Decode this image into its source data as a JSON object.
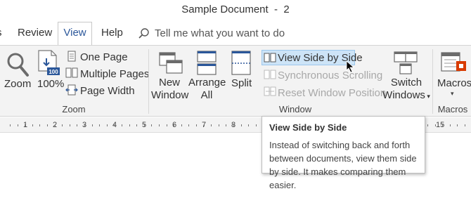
{
  "window": {
    "title": "Sample Document  -  2"
  },
  "tabs": [
    {
      "label": "s"
    },
    {
      "label": "Review"
    },
    {
      "label": "View"
    },
    {
      "label": "Help"
    }
  ],
  "tellme": {
    "placeholder": "Tell me what you want to do"
  },
  "ribbon": {
    "zoom_group": {
      "label": "Zoom",
      "zoom_label": "Zoom",
      "hundred_label": "100%",
      "hundred_badge": "100",
      "one_page": "One Page",
      "multiple_pages": "Multiple Pages",
      "page_width": "Page Width"
    },
    "window_group": {
      "label": "Window",
      "new_window": [
        "New",
        "Window"
      ],
      "arrange_all": [
        "Arrange",
        "All"
      ],
      "split": "Split",
      "view_side_by_side": "View Side by Side",
      "synchronous_scrolling": "Synchronous Scrolling",
      "reset_window_position": "Reset Window Position",
      "switch_windows": [
        "Switch",
        "Windows"
      ]
    },
    "macros_group": {
      "label": "Macros",
      "macros": "Macros"
    }
  },
  "ruler": {
    "numbers": [
      "1",
      "2",
      "3",
      "4",
      "5",
      "6",
      "7",
      "8",
      "15"
    ]
  },
  "tooltip": {
    "title": "View Side by Side",
    "body": "Instead of switching back and forth between documents, view them side by side. It makes comparing them easier."
  },
  "colors": {
    "accent": "#2b579a",
    "ribbon_bg": "#f3f3f3",
    "highlight": "#cde4f7",
    "macro_red": "#d83b01"
  }
}
